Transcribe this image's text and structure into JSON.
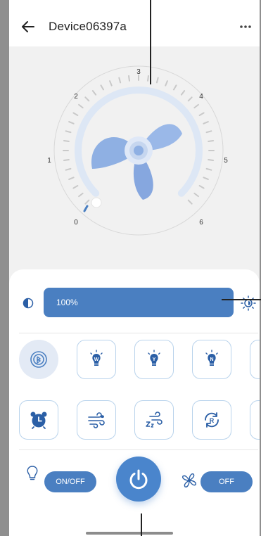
{
  "header": {
    "back_icon": "arrow-left-icon",
    "title": "Device06397a",
    "more_icon": "more-dots-icon"
  },
  "dial": {
    "labels": [
      "0",
      "1",
      "2",
      "3",
      "4",
      "5",
      "6"
    ],
    "current_speed": 0,
    "center_icon": "fan-icon"
  },
  "brightness": {
    "icon": "contrast-icon",
    "value": "100%",
    "level_fraction": 1.0,
    "sun_icon": "sun-icon"
  },
  "modes_row1": [
    {
      "icon": "bluetooth-icon",
      "active": true
    },
    {
      "icon": "bulb-w-icon",
      "letter": "W"
    },
    {
      "icon": "bulb-y-icon",
      "letter": "Y"
    },
    {
      "icon": "bulb-n-icon",
      "letter": "N"
    },
    {
      "icon": "more-mode-icon"
    }
  ],
  "modes_row2": [
    {
      "icon": "alarm-clock-icon"
    },
    {
      "icon": "natural-wind-icon"
    },
    {
      "icon": "sleep-wind-icon"
    },
    {
      "icon": "reverse-icon",
      "letter": "R"
    },
    {
      "icon": "more-mode-icon"
    }
  ],
  "controls": {
    "light_icon": "lightbulb-icon",
    "light_toggle": "ON/OFF",
    "power_icon": "power-icon",
    "fan_icon": "fan-small-icon",
    "fan_toggle": "OFF"
  },
  "colors": {
    "accent": "#4a7fc1",
    "fan_blue": "#8fb0e3",
    "tile_border": "#b9d3ec",
    "background": "#f1f1f1"
  }
}
